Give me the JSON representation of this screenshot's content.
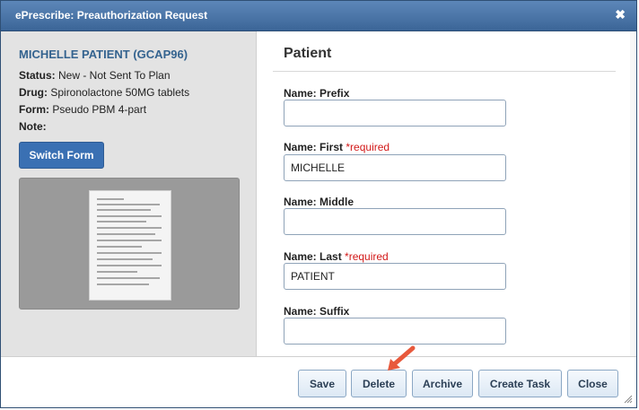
{
  "dialog": {
    "title": "ePrescribe: Preauthorization Request",
    "close_glyph": "✖"
  },
  "left": {
    "patient_name": "MICHELLE PATIENT (GCAP96)",
    "status_label": "Status:",
    "status_value": "New - Not Sent To Plan",
    "drug_label": "Drug:",
    "drug_value": "Spironolactone 50MG tablets",
    "form_label": "Form:",
    "form_value": "Pseudo PBM 4-part",
    "note_label": "Note:",
    "switch_form_label": "Switch Form"
  },
  "right": {
    "section_title": "Patient",
    "fields": [
      {
        "label": "Name: Prefix",
        "required": "",
        "value": ""
      },
      {
        "label": "Name: First",
        "required": "*required",
        "value": "MICHELLE"
      },
      {
        "label": "Name: Middle",
        "required": "",
        "value": ""
      },
      {
        "label": "Name: Last",
        "required": "*required",
        "value": "PATIENT"
      },
      {
        "label": "Name: Suffix",
        "required": "",
        "value": ""
      }
    ]
  },
  "footer": {
    "save_label": "Save",
    "delete_label": "Delete",
    "archive_label": "Archive",
    "create_task_label": "Create Task",
    "close_label": "Close"
  },
  "colors": {
    "titlebar": "#4a76aa",
    "accent": "#3a70b3",
    "required": "#d21818",
    "arrow": "#e8593c"
  },
  "icons": {
    "close": "close-icon",
    "arrow": "pointer-arrow-icon",
    "resize": "resize-grip-icon"
  }
}
